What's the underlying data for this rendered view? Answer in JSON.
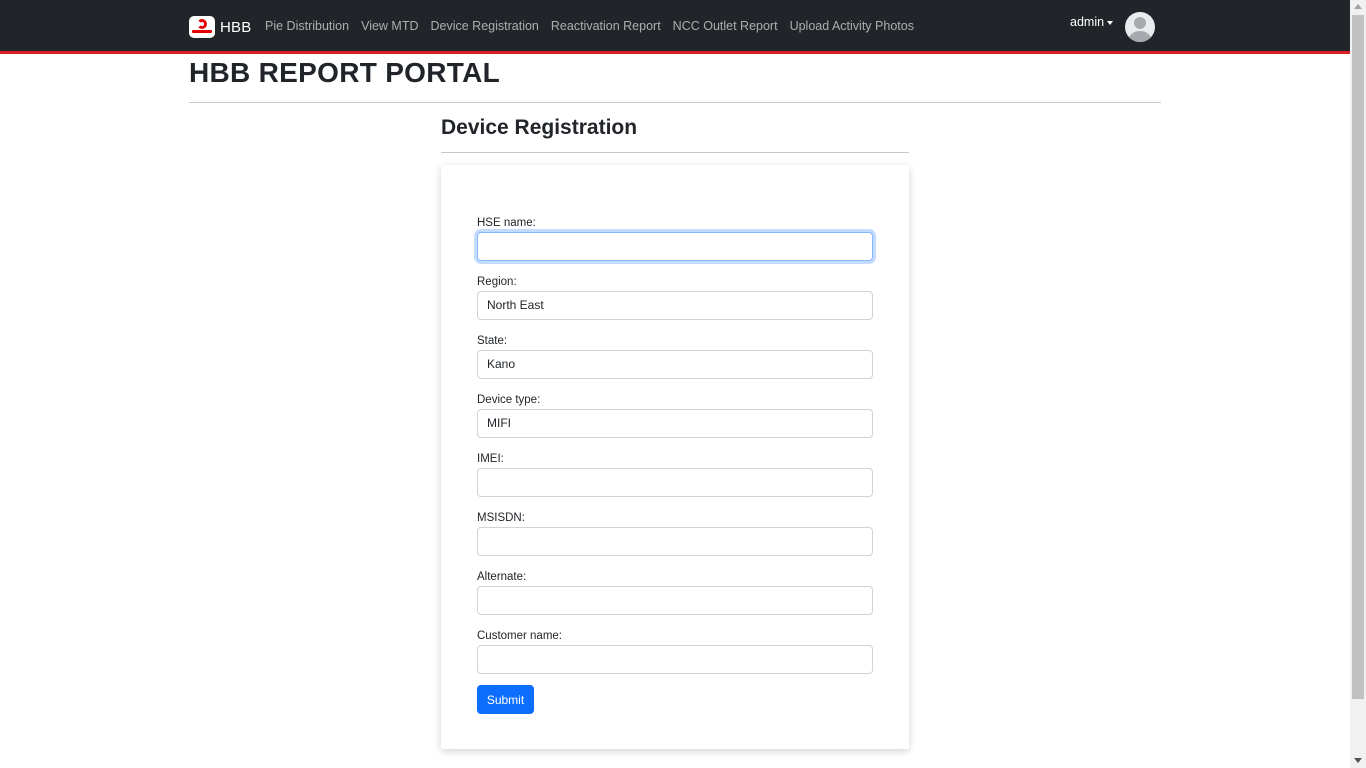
{
  "navbar": {
    "brand_logo_icon": "airtel-logo-icon",
    "brand": "HBB",
    "links": [
      "Pie Distribution",
      "View MTD",
      "Device Registration",
      "Reactivation Report",
      "NCC Outlet Report",
      "Upload Activity Photos"
    ],
    "user": "admin",
    "avatar_icon": "user-avatar-icon",
    "accent_color": "#dc1f26"
  },
  "page": {
    "title": "HBB REPORT PORTAL"
  },
  "form": {
    "title": "Device Registration",
    "fields": {
      "hse_name": {
        "label": "HSE name:",
        "value": ""
      },
      "region": {
        "label": "Region:",
        "value": "North East"
      },
      "state": {
        "label": "State:",
        "value": "Kano"
      },
      "device_type": {
        "label": "Device type:",
        "value": "MIFI"
      },
      "imei": {
        "label": "IMEI:",
        "value": ""
      },
      "msisdn": {
        "label": "MSISDN:",
        "value": ""
      },
      "alternate": {
        "label": "Alternate:",
        "value": ""
      },
      "customer_name": {
        "label": "Customer name:",
        "value": ""
      }
    },
    "submit_label": "Submit",
    "submit_color": "#0d6efd"
  }
}
